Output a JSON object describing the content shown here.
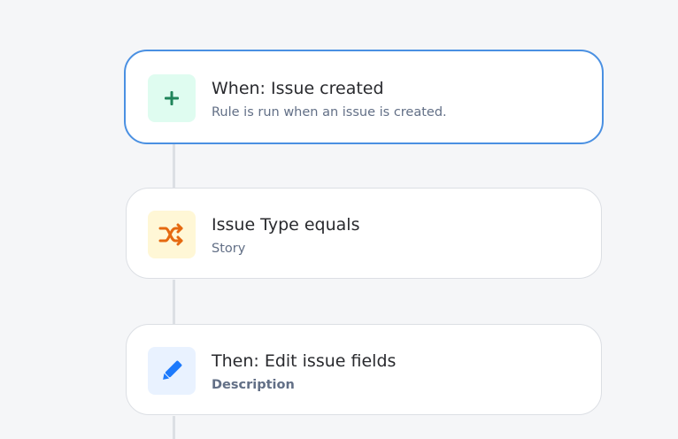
{
  "steps": [
    {
      "title": "When: Issue created",
      "subtitle": "Rule is run when an issue is created.",
      "icon": "plus-icon",
      "color": "#1f845a",
      "bg": "#dffcf0",
      "selected": true
    },
    {
      "title": "Issue Type equals",
      "subtitle": "Story",
      "icon": "shuffle-icon",
      "color": "#e56910",
      "bg": "#fff7d6",
      "selected": false
    },
    {
      "title": "Then: Edit issue fields",
      "subtitle": "Description",
      "icon": "pencil-icon",
      "color": "#1d7afc",
      "bg": "#e9f2ff",
      "selected": false
    }
  ]
}
